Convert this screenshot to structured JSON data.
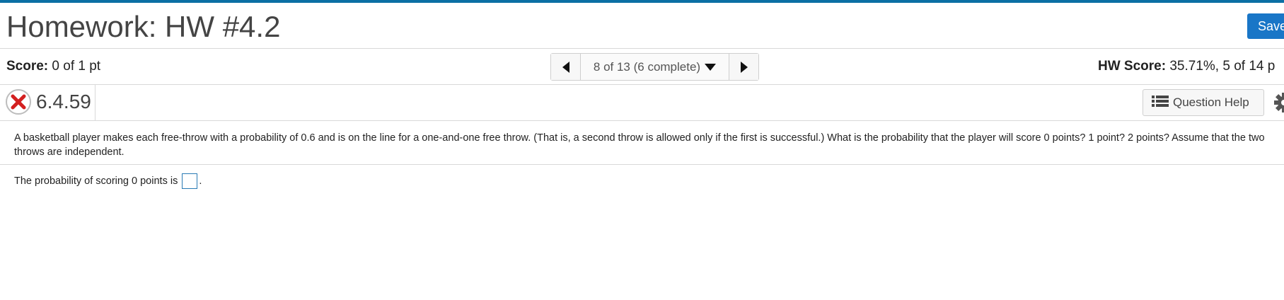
{
  "header": {
    "title": "Homework: HW #4.2",
    "save_label": "Save"
  },
  "score_bar": {
    "score_label": "Score:",
    "score_value": "0 of 1 pt",
    "pager_text": "8 of 13 (6 complete)",
    "hw_score_label": "HW Score:",
    "hw_score_value": "35.71%, 5 of 14 p"
  },
  "question": {
    "status": "incorrect",
    "number": "6.4.59",
    "help_label": "Question Help",
    "text": "A basketball player makes each free-throw with a probability of 0.6 and is on the line for a one-and-one free throw. (That is, a second throw is allowed only if the first is successful.) What is the probability that the player will score 0 points? 1 point? 2 points? Assume that the two throws are independent.",
    "answer_prefix": "The probability of scoring 0 points is",
    "answer_suffix": ".",
    "answer_value": ""
  },
  "colors": {
    "accent": "#0b6fa4",
    "save_button": "#1976c7",
    "incorrect": "#d32020"
  },
  "icons": {
    "prev": "triangle-left-icon",
    "next": "triangle-right-icon",
    "dropdown": "triangle-down-icon",
    "status": "x-circle-icon",
    "help": "list-icon",
    "settings": "gear-icon"
  }
}
